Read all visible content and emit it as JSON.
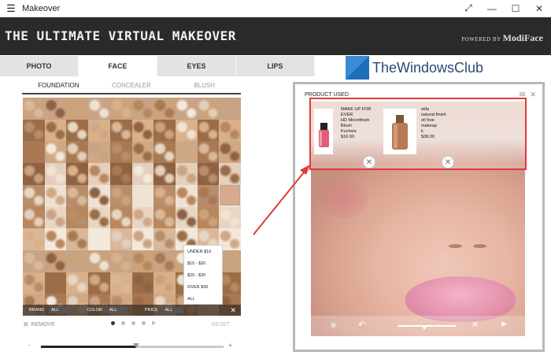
{
  "window": {
    "title": "Makeover",
    "menu_icon": "hamburger-icon",
    "controls": [
      "expand",
      "minimize",
      "maximize",
      "close"
    ]
  },
  "header": {
    "title": "THE ULTIMATE VIRTUAL MAKEOVER",
    "powered_prefix": "POWERED BY",
    "powered_brand": "ModiFace"
  },
  "tabs": [
    "PHOTO",
    "FACE",
    "EYES",
    "LIPS"
  ],
  "active_tab": "FACE",
  "subtabs": [
    "FOUNDATION",
    "CONCEALER",
    "BLUSH"
  ],
  "active_subtab": "FOUNDATION",
  "filters": {
    "brand_label": "BRAND",
    "brand_value": "ALL",
    "color_label": "COLOR",
    "color_value": "ALL",
    "price_label": "PRICE",
    "price_value": "ALL"
  },
  "price_options": [
    "UNDER $10",
    "$10 - $20",
    "$20 - $30",
    "OVER $30",
    "ALL"
  ],
  "controls": {
    "remove": "REMOVE",
    "reset": "RESET"
  },
  "pagination": {
    "pages": 4,
    "current": 1
  },
  "intensity": {
    "minus": "-",
    "plus": "+",
    "level": 0.52
  },
  "watermark": "TheWindowsClub",
  "panel": {
    "title": "PRODUCT USED"
  },
  "products": [
    {
      "lines": [
        "MAKE UP FOR",
        "EVER",
        "HD Microfinish",
        "Blush",
        "Fuchsia",
        "$16.00"
      ]
    },
    {
      "lines": [
        "stila",
        "natural finish",
        "oil free",
        "makeup",
        "k",
        "$38.00"
      ]
    }
  ],
  "colors": {
    "header_bg": "#2a2a2a",
    "highlight": "#e03a3a",
    "accent": "#1d6fb8"
  }
}
